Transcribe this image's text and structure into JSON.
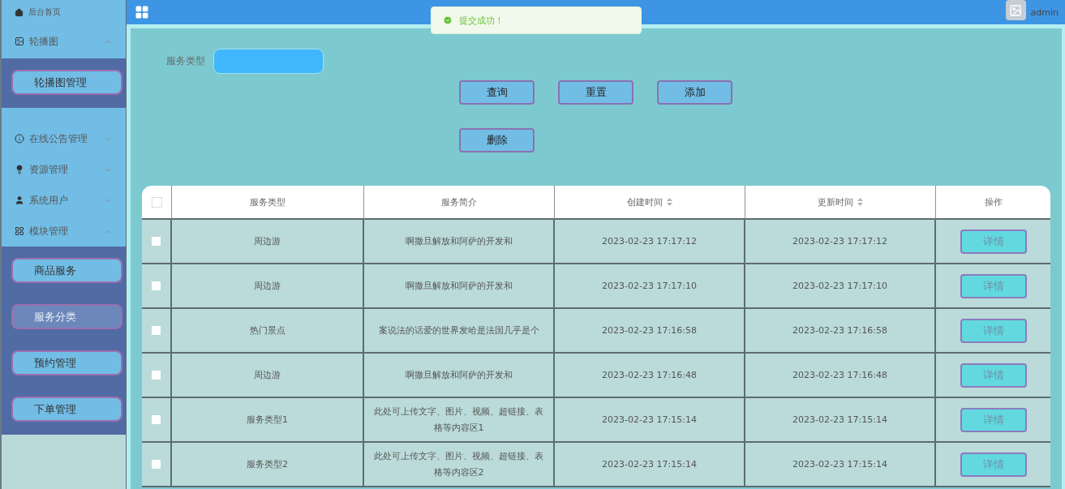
{
  "sidebar": {
    "items": [
      {
        "label": "后台首页",
        "kind": "link"
      },
      {
        "label": "轮播图",
        "kind": "group",
        "expanded": true,
        "children": [
          {
            "label": "轮播图管理",
            "selected": false
          }
        ]
      },
      {
        "label": "在线公告管理",
        "kind": "group",
        "expanded": false
      },
      {
        "label": "资源管理",
        "kind": "group",
        "expanded": false
      },
      {
        "label": "系统用户",
        "kind": "group",
        "expanded": false
      },
      {
        "label": "模块管理",
        "kind": "group",
        "expanded": true,
        "children": [
          {
            "label": "商品服务",
            "selected": false
          },
          {
            "label": "服务分类",
            "selected": true
          },
          {
            "label": "预约管理",
            "selected": false
          },
          {
            "label": "下单管理",
            "selected": false
          }
        ]
      }
    ]
  },
  "topbar": {
    "user": "admin"
  },
  "toast": {
    "kind": "success",
    "message": "提交成功！"
  },
  "search": {
    "label": "服务类型"
  },
  "buttons": [
    [
      "查询",
      "重置",
      "添加"
    ],
    [
      "删除"
    ]
  ],
  "table": {
    "columns": [
      {
        "kind": "checkbox",
        "checked": false
      },
      {
        "kind": "text",
        "label": "服务类型",
        "sortable": false
      },
      {
        "kind": "text",
        "label": "服务简介",
        "sortable": false
      },
      {
        "kind": "text",
        "label": "创建时间",
        "sortable": true
      },
      {
        "kind": "text",
        "label": "更新时间",
        "sortable": true
      },
      {
        "kind": "text",
        "label": "操作",
        "sortable": false
      }
    ],
    "rows": [
      {
        "checked": false,
        "type": "周边游",
        "intro": "啊撒旦解放和阿萨的开发和",
        "created": "2023-02-23 17:17:12",
        "updated": "2023-02-23 17:17:12",
        "action": "详情"
      },
      {
        "checked": false,
        "type": "周边游",
        "intro": "啊撒旦解放和阿萨的开发和",
        "created": "2023-02-23 17:17:10",
        "updated": "2023-02-23 17:17:10",
        "action": "详情"
      },
      {
        "checked": false,
        "type": "热门景点",
        "intro": "案说法的话爱的世界发哈是法国几乎是个",
        "created": "2023-02-23 17:16:58",
        "updated": "2023-02-23 17:16:58",
        "action": "详情"
      },
      {
        "checked": false,
        "type": "周边游",
        "intro": "啊撒旦解放和阿萨的开发和",
        "created": "2023-02-23 17:16:48",
        "updated": "2023-02-23 17:16:48",
        "action": "详情"
      },
      {
        "checked": false,
        "type": "服务类型1",
        "intro": "此处可上传文字、图片、视频、超链接、表格等内容区1",
        "created": "2023-02-23 17:15:14",
        "updated": "2023-02-23 17:15:14",
        "action": "详情"
      },
      {
        "checked": false,
        "type": "服务类型2",
        "intro": "此处可上传文字、图片、视频、超链接、表格等内容区2",
        "created": "2023-02-23 17:15:14",
        "updated": "2023-02-23 17:15:14",
        "action": "详情"
      }
    ]
  }
}
